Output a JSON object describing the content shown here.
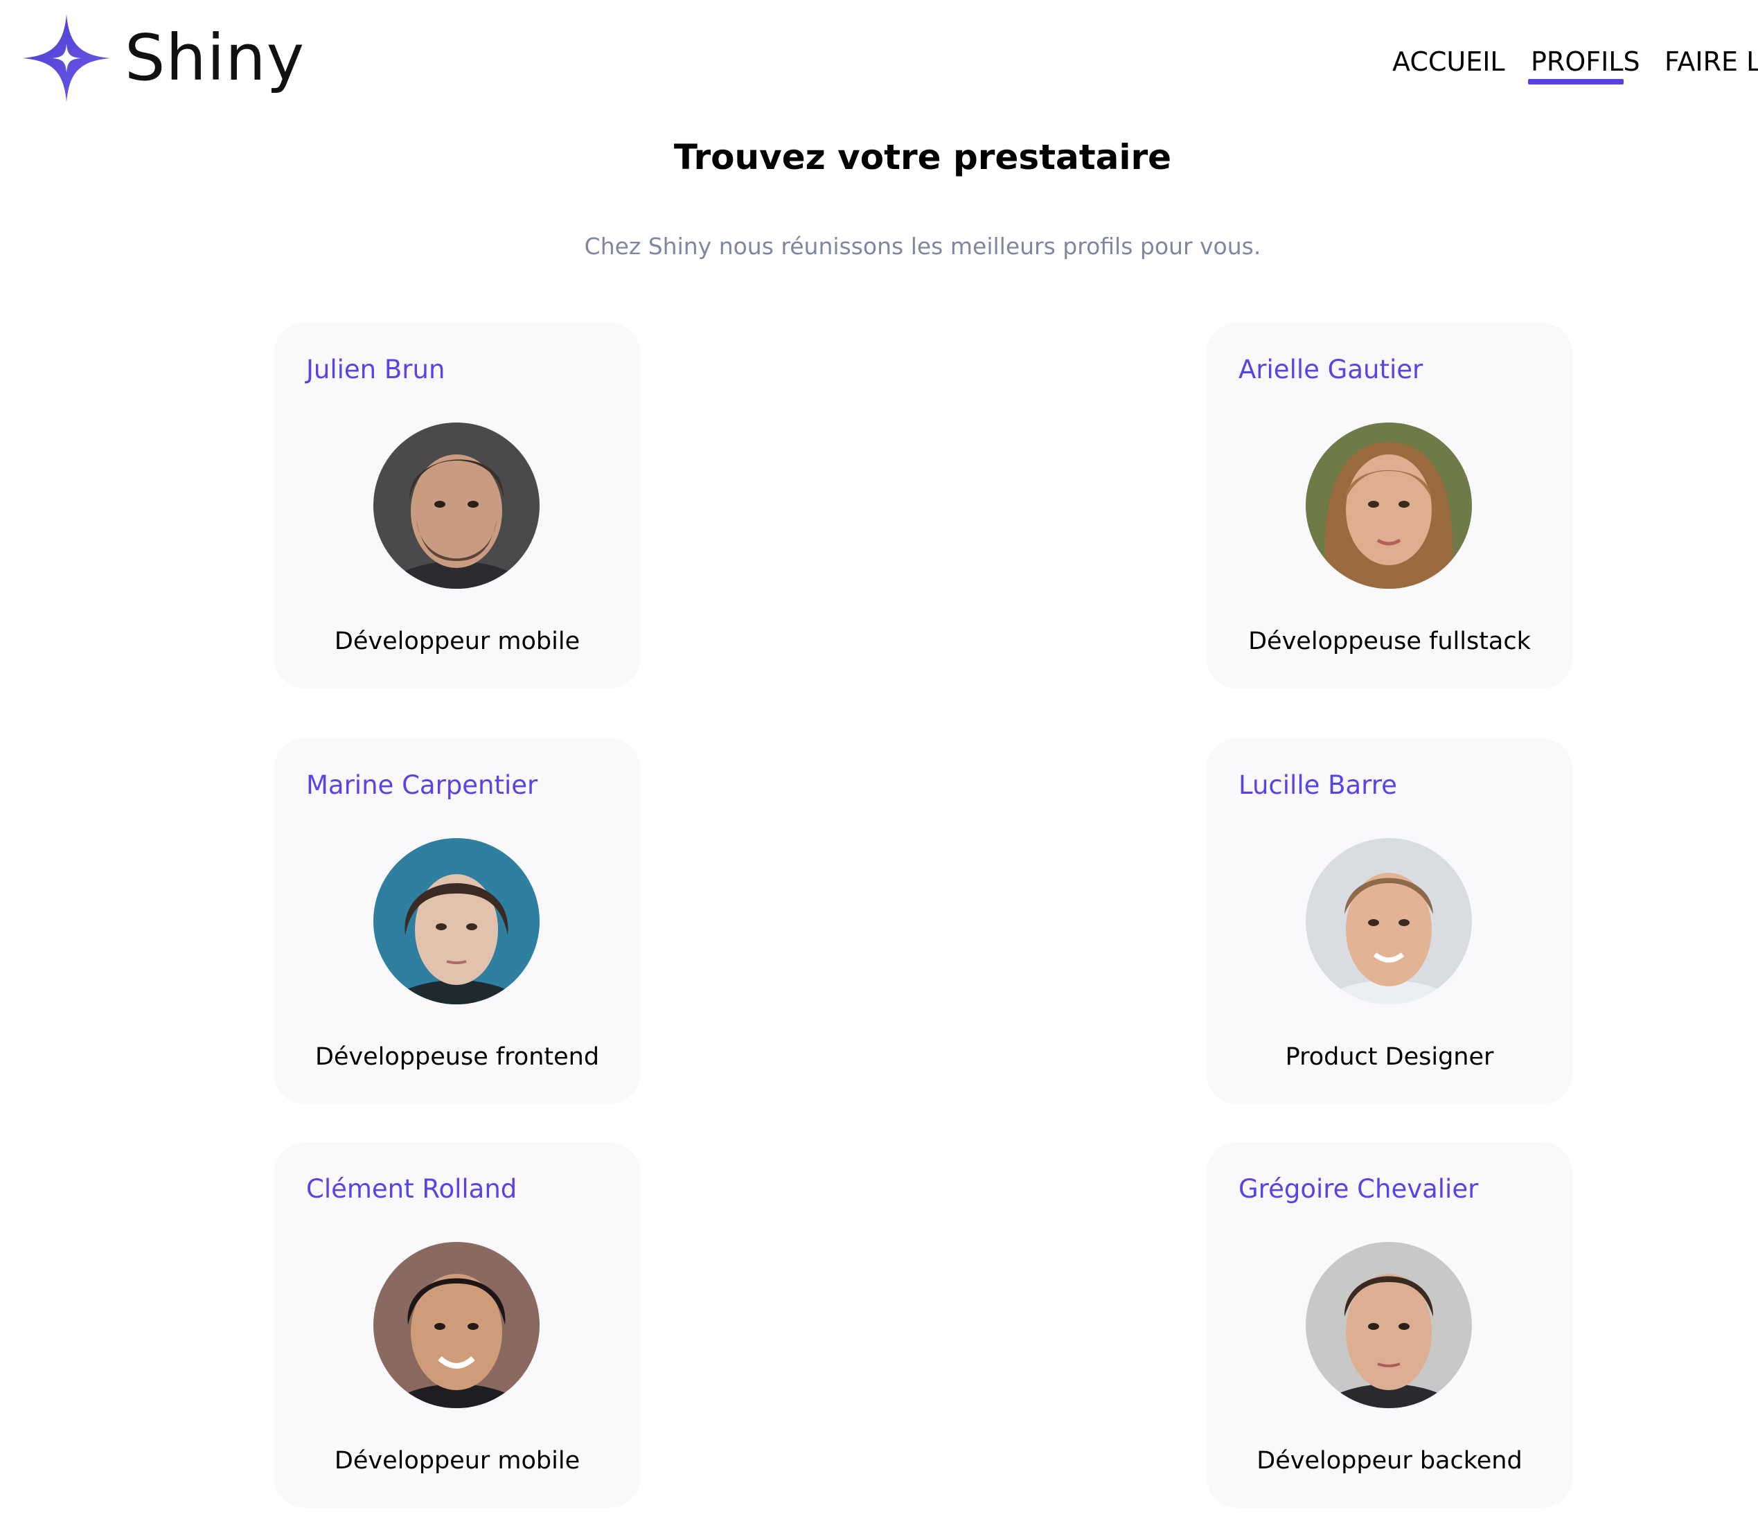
{
  "header": {
    "brand": "Shiny",
    "nav": [
      {
        "label": "ACCUEIL"
      },
      {
        "label": "PROFILS",
        "active": true
      },
      {
        "label": "FAIRE LE"
      }
    ],
    "accent_color": "#5843e4"
  },
  "main": {
    "title": "Trouvez votre prestataire",
    "subtitle": "Chez Shiny nous réunissons les meilleurs profils pour vous."
  },
  "profiles": [
    {
      "name": "Julien Brun",
      "job": "Développeur mobile"
    },
    {
      "name": "Arielle Gautier",
      "job": "Développeuse fullstack"
    },
    {
      "name": "Marine Carpentier",
      "job": "Développeuse frontend"
    },
    {
      "name": "Lucille Barre",
      "job": "Product Designer"
    },
    {
      "name": "Clément Rolland",
      "job": "Développeur mobile"
    },
    {
      "name": "Grégoire Chevalier",
      "job": "Développeur backend"
    }
  ],
  "colors": {
    "card_background": "#f9f9fc",
    "name_color": "#5843e4",
    "subtitle_color": "#8186a0"
  }
}
